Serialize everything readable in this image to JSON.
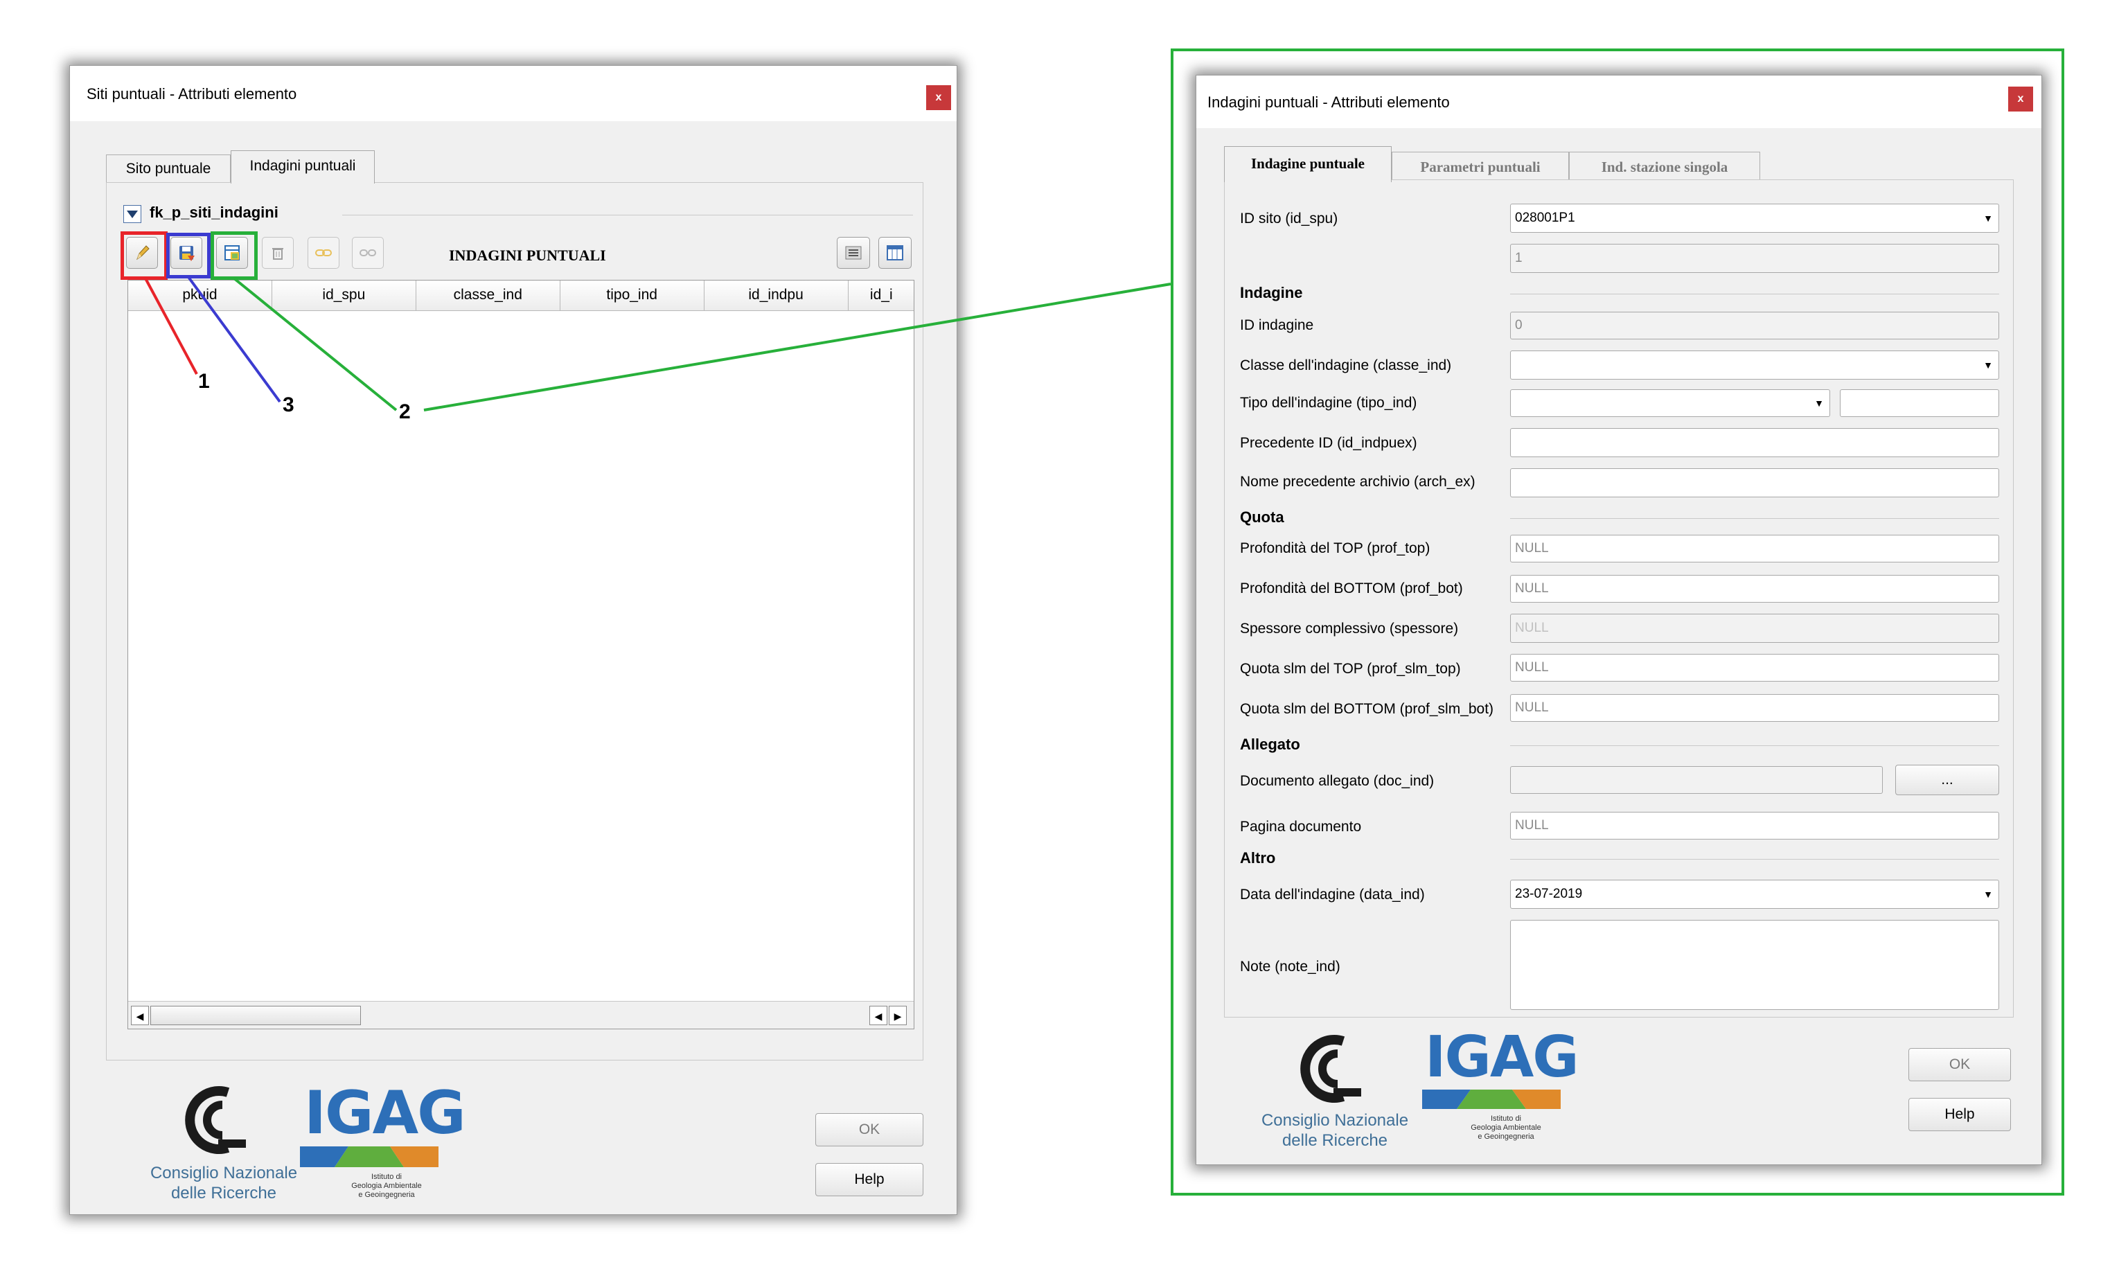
{
  "left_dialog": {
    "title": "Siti puntuali - Attributi elemento",
    "close_icon": "close-icon",
    "tabs": [
      "Sito puntuale",
      "Indagini puntuali"
    ],
    "relation_name": "fk_p_siti_indagini",
    "toolbar_title": "INDAGINI PUNTUALI",
    "toolbar_icons": [
      "edit-pencil-icon",
      "save-edits-icon",
      "add-feature-icon",
      "delete-feature-icon",
      "link-feature-icon",
      "unlink-feature-icon",
      "form-view-icon",
      "table-view-icon"
    ],
    "columns": [
      "pkuid",
      "id_spu",
      "classe_ind",
      "tipo_ind",
      "id_indpu",
      "id_i"
    ],
    "ok_label": "OK",
    "help_label": "Help"
  },
  "callouts": {
    "one": "1",
    "two": "2",
    "three": "3",
    "colors": {
      "red": "#e8242a",
      "blue": "#3b3bd0",
      "green": "#27b03a"
    }
  },
  "right_dialog": {
    "title": "Indagini puntuali - Attributi elemento",
    "tabs": [
      "Indagine puntuale",
      "Parametri puntuali",
      "Ind. stazione singola"
    ],
    "id_sito_label": "ID sito (id_spu)",
    "id_sito_value": "028001P1",
    "id_sito_sub_value": "1",
    "section_indagine": "Indagine",
    "id_indagine_label": "ID indagine",
    "id_indagine_value": "0",
    "classe_label": "Classe dell'indagine (classe_ind)",
    "classe_value": "",
    "tipo_label": "Tipo dell'indagine (tipo_ind)",
    "tipo_value": "",
    "prec_id_label": "Precedente ID (id_indpuex)",
    "prec_id_value": "",
    "nome_prec_label": "Nome precedente archivio (arch_ex)",
    "nome_prec_value": "",
    "section_quota": "Quota",
    "prof_top_label": "Profondità del TOP (prof_top)",
    "prof_top_value": "NULL",
    "prof_bot_label": "Profondità del BOTTOM (prof_bot)",
    "prof_bot_value": "NULL",
    "spessore_label": "Spessore complessivo (spessore)",
    "spessore_value": "NULL",
    "slm_top_label": "Quota slm del TOP (prof_slm_top)",
    "slm_top_value": "NULL",
    "slm_bot_label": "Quota slm del BOTTOM (prof_slm_bot)",
    "slm_bot_value": "NULL",
    "section_allegato": "Allegato",
    "doc_label": "Documento allegato (doc_ind)",
    "doc_value": "",
    "browse_label": "...",
    "pagina_label": "Pagina documento",
    "pagina_value": "NULL",
    "section_altro": "Altro",
    "data_label": "Data dell'indagine (data_ind)",
    "data_value": "23-07-2019",
    "note_label": "Note (note_ind)",
    "note_value": "",
    "ok_label": "OK",
    "help_label": "Help"
  },
  "logos": {
    "igag": "IGAG",
    "cnr_line1": "Consiglio Nazionale",
    "cnr_line2": "delle Ricerche",
    "igag_line1": "Istituto di",
    "igag_line2": "Geologia Ambientale",
    "igag_line3": "e Geoingegneria"
  }
}
